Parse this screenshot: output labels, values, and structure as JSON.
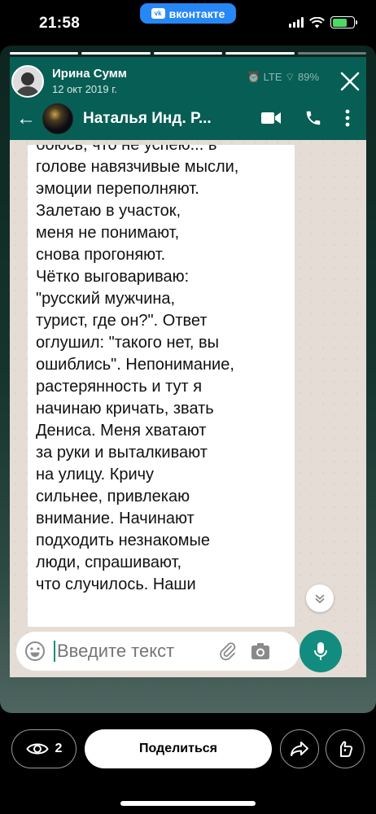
{
  "status_bar": {
    "time": "21:58",
    "app_badge": "вконтакте",
    "vk_logo_text": "vk",
    "battery_level": 0.7,
    "battery_color": "#4cd964"
  },
  "story": {
    "author": "Ирина Сумм",
    "date": "12 окт 2019 г.",
    "progress_segments": 5,
    "progress_done": 4,
    "background_status": "⏰ LTE ⌔ 89%"
  },
  "whatsapp": {
    "contact_name": "Наталья Инд. Р...",
    "message": "боюсь, что не успею... в\nголове навязчивые мысли,\nэмоции переполняют.\nЗалетаю в участок,\nменя не понимают,\nснова прогоняют.\nЧётко выговариваю:\n\"русский мужчина,\nтурист, где он?\". Ответ\nоглушил: \"такого нет, вы\nошиблись\".  Непонимание,\nрастерянность и тут я\nначинаю кричать, звать\nДениса. Меня хватают\nза руки и выталкивают\nна улицу. Кричу\nсильнее, привлекаю\nвнимание. Начинают\nподходить незнакомые\nлюди, спрашивают,\nчто случилось. Наши",
    "input_placeholder": "Введите текст",
    "header_color": "#075e54",
    "accent_color": "#128c7e"
  },
  "bottom_bar": {
    "viewers_count": "2",
    "share_label": "Поделиться"
  },
  "icons": [
    "eye-icon",
    "share-arrow-icon",
    "heart-hand-icon",
    "close-icon",
    "video-call-icon",
    "phone-icon",
    "menu-dots-icon",
    "emoji-icon",
    "paperclip-icon",
    "camera-icon",
    "mic-icon",
    "chevron-down-icon"
  ]
}
